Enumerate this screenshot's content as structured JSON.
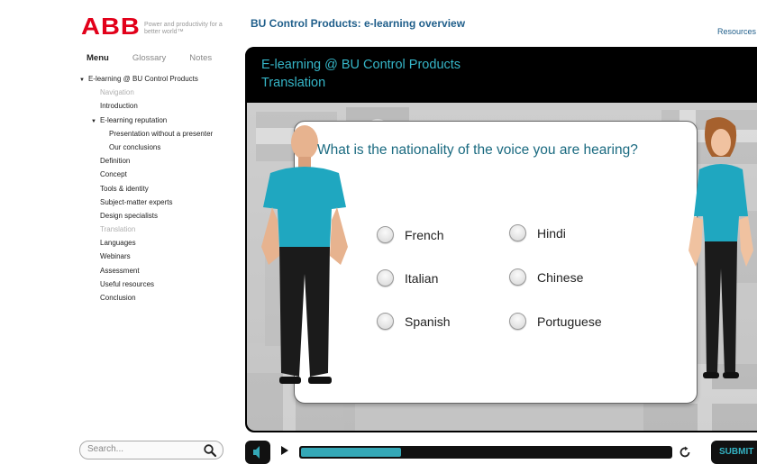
{
  "brand": {
    "logo_text": "ABB",
    "tagline": "Power and productivity for a better world™"
  },
  "header": {
    "course_title": "BU Control Products: e-learning overview",
    "resources_label": "Resources"
  },
  "sidebar": {
    "tabs": [
      {
        "label": "Menu",
        "active": true
      },
      {
        "label": "Glossary",
        "active": false
      },
      {
        "label": "Notes",
        "active": false
      }
    ],
    "items": [
      {
        "label": "E-learning @ BU Control Products",
        "expanded": true
      },
      {
        "label": "Navigation",
        "state": "visited"
      },
      {
        "label": "Introduction"
      },
      {
        "label": "E-learning reputation",
        "expanded": true
      },
      {
        "label": "Presentation without a presenter"
      },
      {
        "label": "Our conclusions"
      },
      {
        "label": "Definition"
      },
      {
        "label": "Concept"
      },
      {
        "label": "Tools & identity"
      },
      {
        "label": "Subject-matter experts"
      },
      {
        "label": "Design specialists"
      },
      {
        "label": "Translation",
        "state": "current"
      },
      {
        "label": "Languages"
      },
      {
        "label": "Webinars"
      },
      {
        "label": "Assessment"
      },
      {
        "label": "Useful resources"
      },
      {
        "label": "Conclusion"
      }
    ],
    "search_placeholder": "Search..."
  },
  "slide": {
    "title": "E-learning @ BU Control Products",
    "subtitle": "Translation",
    "question": "What is the nationality of the voice you are hearing?",
    "options": [
      "French",
      "Hindi",
      "Italian",
      "Chinese",
      "Spanish",
      "Portuguese"
    ]
  },
  "player": {
    "progress_fraction": 0.27,
    "submit_label": "SUBMIT"
  },
  "colors": {
    "brand_red": "#e2001a",
    "accent_teal": "#34a8b7",
    "title_blue": "#1f5e8a"
  }
}
